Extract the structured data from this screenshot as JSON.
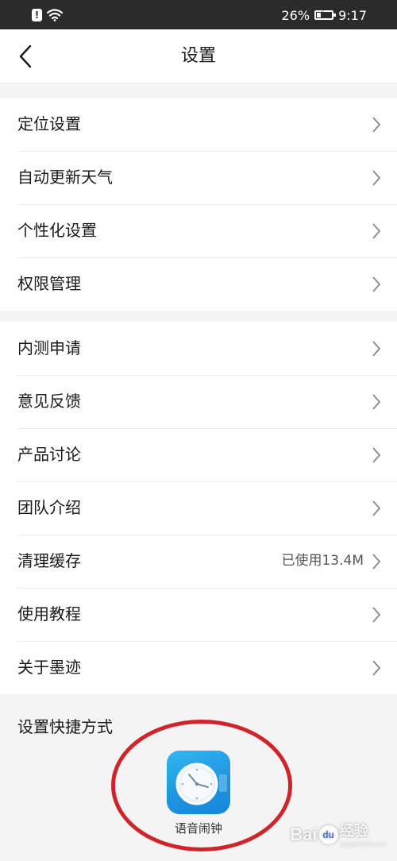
{
  "status_bar": {
    "battery": "26%",
    "time": "9:17",
    "battery_level": 0.26,
    "icons": [
      "alert-icon",
      "wifi-icon",
      "battery-charging-icon"
    ]
  },
  "nav": {
    "title": "设置",
    "back_icon": "chevron-left-icon"
  },
  "group1": [
    {
      "label": "定位设置"
    },
    {
      "label": "自动更新天气"
    },
    {
      "label": "个性化设置"
    },
    {
      "label": "权限管理"
    }
  ],
  "group2": [
    {
      "label": "内测申请"
    },
    {
      "label": "意见反馈"
    },
    {
      "label": "产品讨论"
    },
    {
      "label": "团队介绍"
    },
    {
      "label": "清理缓存",
      "value": "已使用13.4M"
    },
    {
      "label": "使用教程"
    },
    {
      "label": "关于墨迹"
    }
  ],
  "shortcut": {
    "title": "设置快捷方式",
    "app_name": "语音闹钟",
    "app_icon": "clock-icon"
  },
  "watermark": {
    "text": "Bai",
    "paw": "du",
    "sub": "经验",
    "sub_en": "jingyan.baidu.com"
  },
  "colors": {
    "accent_circle": "#d0242b",
    "app_icon_blue": "#1e93e0",
    "status_bar_bg": "#2b2b2b"
  }
}
